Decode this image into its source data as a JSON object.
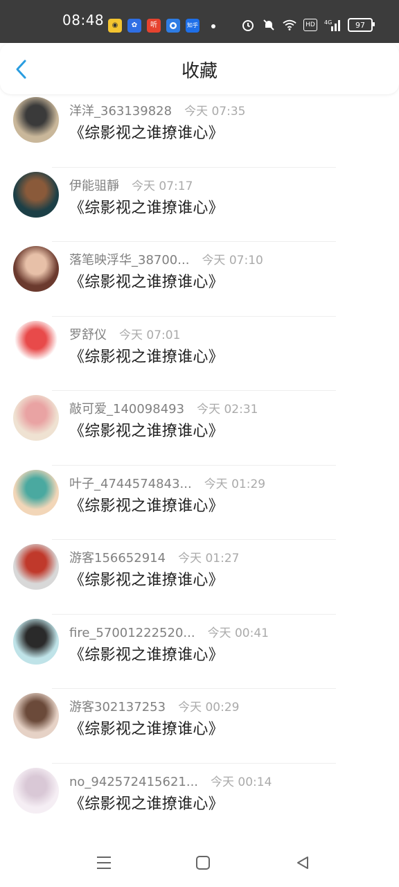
{
  "status_bar": {
    "time": "08:48",
    "app_icons": [
      {
        "name": "lightbulb-app-icon",
        "glyph": "💡",
        "color": "#ffffff"
      },
      {
        "name": "baidu-app-icon",
        "glyph": "🐾",
        "color": "#2f6fe4"
      },
      {
        "name": "ting-app-icon",
        "glyph": "听",
        "color": "#e6432f"
      },
      {
        "name": "circle-app-icon",
        "glyph": "●",
        "color": "#2f7de4"
      },
      {
        "name": "zhihu-app-icon",
        "glyph": "知乎",
        "color": "#1e6fe8"
      }
    ],
    "hd_label": "HD",
    "network_label": "4G",
    "battery": "97"
  },
  "header": {
    "title": "收藏",
    "accent": "#2a9de0"
  },
  "items": [
    {
      "name": "洋洋_363139828",
      "time": "今天 07:35",
      "book": "《综影视之谁撩谁心》",
      "avatar_colors": [
        "#c9b79a",
        "#3a3a3a"
      ]
    },
    {
      "name": "伊能驵靜",
      "time": "今天 07:17",
      "book": "《综影视之谁撩谁心》",
      "avatar_colors": [
        "#1c3f46",
        "#8a5a3a"
      ]
    },
    {
      "name": "落笔映浮华_38700...",
      "time": "今天 07:10",
      "book": "《综影视之谁撩谁心》",
      "avatar_colors": [
        "#6b3a2e",
        "#e7c0a8"
      ]
    },
    {
      "name": "罗舒仪",
      "time": "今天 07:01",
      "book": "《综影视之谁撩谁心》",
      "avatar_colors": [
        "#ffffff",
        "#e84a4a"
      ]
    },
    {
      "name": "敲可爱_140098493",
      "time": "今天 02:31",
      "book": "《综影视之谁撩谁心》",
      "avatar_colors": [
        "#efe2d2",
        "#e9a3a3"
      ]
    },
    {
      "name": "叶子_4744574843...",
      "time": "今天 01:29",
      "book": "《综影视之谁撩谁心》",
      "avatar_colors": [
        "#f2d6b8",
        "#4aa9a0"
      ]
    },
    {
      "name": "游客156652914",
      "time": "今天 01:27",
      "book": "《综影视之谁撩谁心》",
      "avatar_colors": [
        "#d8d8d8",
        "#c0392b"
      ]
    },
    {
      "name": "fire_57001222520...",
      "time": "今天 00:41",
      "book": "《综影视之谁撩谁心》",
      "avatar_colors": [
        "#bfe3e8",
        "#2a2a2a"
      ]
    },
    {
      "name": "游客302137253",
      "time": "今天 00:29",
      "book": "《综影视之谁撩谁心》",
      "avatar_colors": [
        "#e6d2c6",
        "#6b4a3a"
      ]
    },
    {
      "name": "no_942572415621...",
      "time": "今天 00:14",
      "book": "《综影视之谁撩谁心》",
      "avatar_colors": [
        "#f5eef4",
        "#d9c8d6"
      ]
    }
  ],
  "nav_bar": {
    "menu": "menu-icon",
    "home": "home-icon",
    "back": "back-triangle-icon"
  }
}
